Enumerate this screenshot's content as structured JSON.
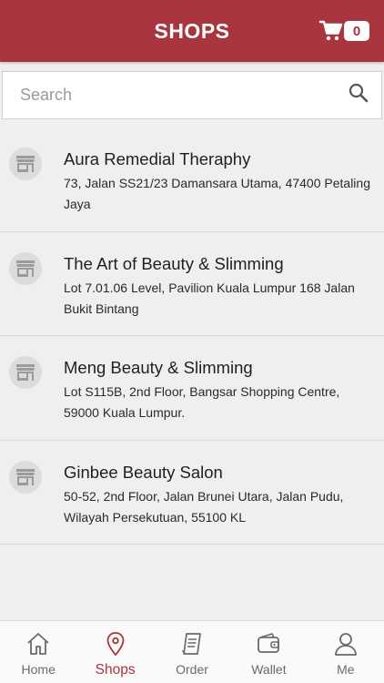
{
  "header": {
    "title": "SHOPS",
    "cart_count": "0"
  },
  "search": {
    "placeholder": "Search",
    "value": ""
  },
  "shops": [
    {
      "name": "Aura Remedial Theraphy",
      "address": "73, Jalan SS21/23 Damansara Utama, 47400 Petaling Jaya"
    },
    {
      "name": "The Art of Beauty & Slimming",
      "address": "Lot 7.01.06 Level, Pavilion Kuala Lumpur 168 Jalan Bukit Bintang"
    },
    {
      "name": "Meng Beauty & Slimming",
      "address": "Lot S115B, 2nd Floor, Bangsar Shopping Centre, 59000 Kuala Lumpur."
    },
    {
      "name": "Ginbee Beauty Salon",
      "address": "50-52, 2nd Floor, Jalan Brunei Utara, Jalan Pudu, Wilayah Persekutuan, 55100 KL"
    }
  ],
  "tabs": [
    {
      "label": "Home",
      "icon": "home-icon",
      "active": false
    },
    {
      "label": "Shops",
      "icon": "location-pin-icon",
      "active": true
    },
    {
      "label": "Order",
      "icon": "receipt-icon",
      "active": false
    },
    {
      "label": "Wallet",
      "icon": "wallet-icon",
      "active": false
    },
    {
      "label": "Me",
      "icon": "person-icon",
      "active": false
    }
  ],
  "colors": {
    "brand": "#a9353f",
    "background": "#efefef",
    "tab_inactive": "#6a6a6a"
  }
}
